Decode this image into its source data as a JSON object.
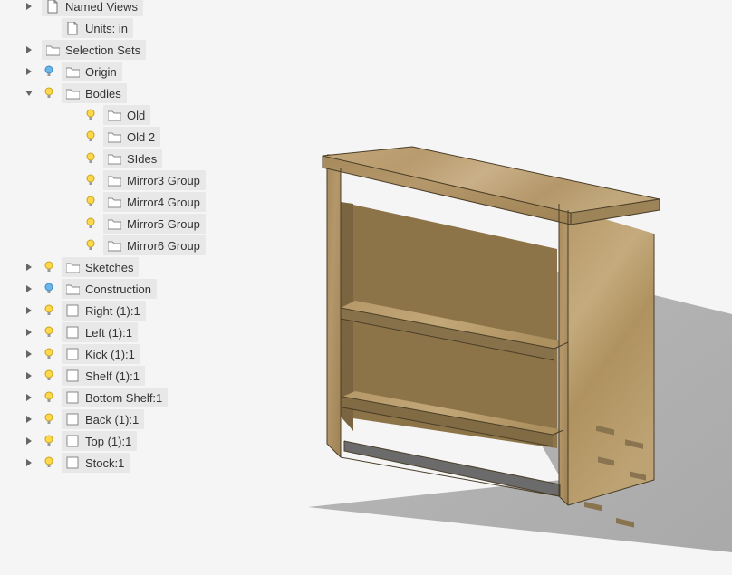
{
  "tree": {
    "namedViews": "Named Views",
    "units": "Units: in",
    "selectionSets": "Selection Sets",
    "origin": "Origin",
    "bodies": "Bodies",
    "bodiesChildren": {
      "old": "Old",
      "old2": "Old 2",
      "sides": "SIdes",
      "mirror3": "Mirror3 Group",
      "mirror4": "Mirror4 Group",
      "mirror5": "Mirror5 Group",
      "mirror6": "Mirror6 Group"
    },
    "sketches": "Sketches",
    "construction": "Construction",
    "right": "Right (1):1",
    "left": "Left (1):1",
    "kick": "Kick (1):1",
    "shelf": "Shelf (1):1",
    "bottomShelf": "Bottom Shelf:1",
    "back": "Back (1):1",
    "top": "Top (1):1",
    "stock": "Stock:1"
  }
}
